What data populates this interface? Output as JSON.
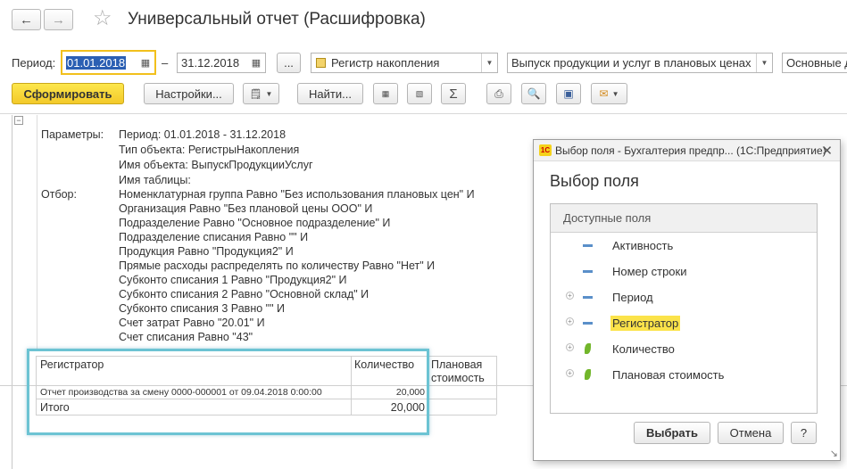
{
  "window": {
    "title": "Универсальный отчет (Расшифровка)"
  },
  "period": {
    "label": "Период:",
    "from": "01.01.2018",
    "separator": "–",
    "to": "31.12.2018",
    "more_label": "...",
    "object_type": "Регистр накопления",
    "object_name": "Выпуск продукции и услуг в плановых ценах",
    "table_name": "Основные д"
  },
  "toolbar": {
    "generate_label": "Сформировать",
    "settings_label": "Настройки...",
    "find_label": "Найти..."
  },
  "report": {
    "params_label": "Параметры:",
    "params_lines": [
      "Период: 01.01.2018 - 31.12.2018",
      "Тип объекта: РегистрыНакопления",
      "Имя объекта: ВыпускПродукцииУслуг",
      "Имя таблицы:"
    ],
    "filter_label": "Отбор:",
    "filter_lines": [
      "Номенклатурная группа Равно \"Без использования плановых цен\" И",
      "Организация Равно \"Без плановой цены ООО\" И",
      "Подразделение Равно \"Основное подразделение\" И",
      "Подразделение списания Равно \"\" И",
      "Продукция Равно \"Продукция2\" И",
      "Прямые расходы распределять по количеству Равно \"Нет\" И",
      "Субконто списания 1 Равно \"Продукция2\" И",
      "Субконто списания 2 Равно \"Основной склад\" И",
      "Субконто списания 3 Равно \"\" И",
      "Счет затрат Равно \"20.01\" И",
      "Счет списания Равно \"43\""
    ],
    "table": {
      "col_registrar": "Регистратор",
      "col_quantity": "Количество",
      "col_planned_1": "Плановая",
      "col_planned_2": "стоимость",
      "row_registrar": "Отчет производства за смену 0000-000001 от 09.04.2018 0:00:00",
      "row_quantity": "20,000",
      "total_label": "Итого",
      "total_quantity": "20,000"
    }
  },
  "dialog": {
    "title": "Выбор поля - Бухгалтерия предпр... (1С:Предприятие)",
    "heading": "Выбор поля",
    "tree_header": "Доступные поля",
    "fields": [
      {
        "label": "Активность",
        "expandable": false,
        "icon": "dimension-icon",
        "selected": false
      },
      {
        "label": "Номер строки",
        "expandable": false,
        "icon": "dimension-icon",
        "selected": false
      },
      {
        "label": "Период",
        "expandable": true,
        "icon": "dimension-icon",
        "selected": false
      },
      {
        "label": "Регистратор",
        "expandable": true,
        "icon": "dimension-icon",
        "selected": true
      },
      {
        "label": "Количество",
        "expandable": true,
        "icon": "resource-icon",
        "selected": false
      },
      {
        "label": "Плановая стоимость",
        "expandable": true,
        "icon": "resource-icon",
        "selected": false
      }
    ],
    "select_label": "Выбрать",
    "cancel_label": "Отмена",
    "help_label": "?"
  },
  "colors": {
    "accent_yellow": "#f5d128",
    "highlight_frame": "#6cc3d3",
    "selection_blue": "#2b5fb3"
  }
}
